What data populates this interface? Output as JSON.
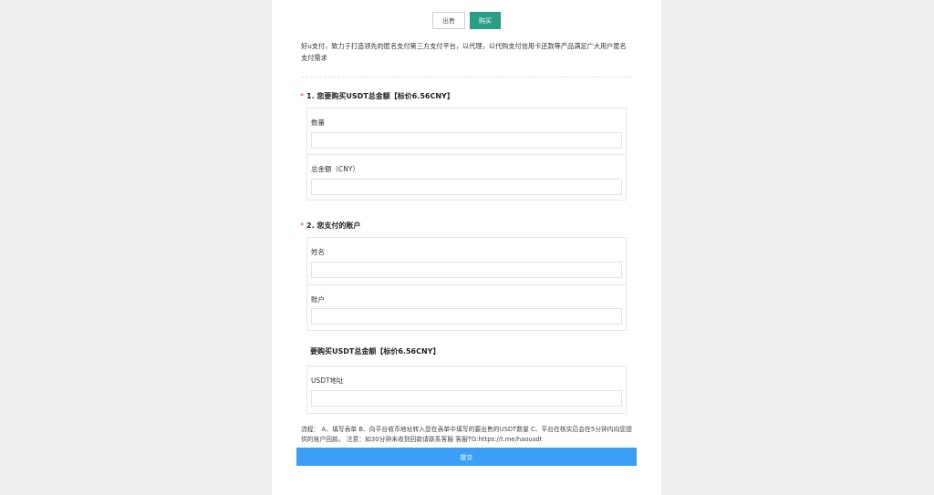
{
  "tabs": {
    "sell_label": "出售",
    "buy_label": "购买"
  },
  "intro_text": "好u支付，致力于打造领先的匿名支付第三方支付平台，以代理，以代购支付信用卡还款等产品满足广大用户匿名支付需求",
  "section1": {
    "title": "1. 您要购买USDT总金额【标价6.56CNY】",
    "fields": [
      {
        "label": "数量",
        "value": ""
      },
      {
        "label": "总金额（CNY）",
        "value": ""
      }
    ]
  },
  "section2": {
    "title": "2. 您支付的账户",
    "fields": [
      {
        "label": "姓名",
        "value": ""
      },
      {
        "label": "账户",
        "value": ""
      }
    ]
  },
  "section3": {
    "title": "要购买USDT总金额【标价6.56CNY】",
    "fields": [
      {
        "label": "USDT地址",
        "value": ""
      }
    ]
  },
  "process_text": "流程： A、填写表单 B、向平台收币地址转入您在表单中填写的要出售的USDT数量 C、平台在核实后会在5分钟内向您提供的账户回款。 注意：如30分钟未收到回款请联系客服 客服TG:https://t.me/haousdt",
  "submit_label": "提交",
  "colors": {
    "accent_green": "#2a9d86",
    "submit_blue": "#3a9ff5",
    "required_red": "#e0453a"
  }
}
